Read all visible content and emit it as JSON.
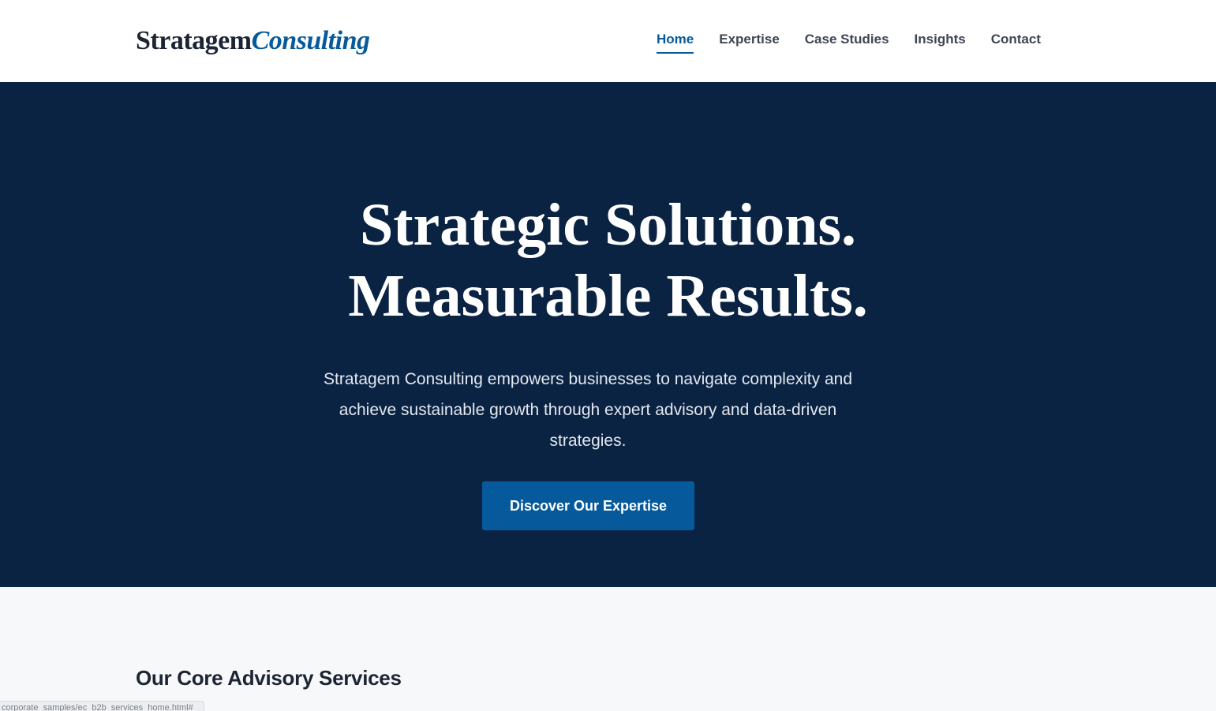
{
  "brand": {
    "name_main": "Stratagem",
    "name_accent": "Consulting"
  },
  "nav": {
    "items": [
      {
        "label": "Home",
        "active": true
      },
      {
        "label": "Expertise",
        "active": false
      },
      {
        "label": "Case Studies",
        "active": false
      },
      {
        "label": "Insights",
        "active": false
      },
      {
        "label": "Contact",
        "active": false
      }
    ]
  },
  "hero": {
    "title_line1": "Strategic Solutions.",
    "title_line2": "Measurable Results.",
    "subtitle": "Stratagem Consulting empowers businesses to navigate complexity and achieve sustainable growth through expert advisory and data-driven strategies.",
    "cta_label": "Discover Our Expertise"
  },
  "services": {
    "heading": "Our Core Advisory Services"
  },
  "status_bar": {
    "url": "corporate_samples/ec_b2b_services_home.html#"
  },
  "colors": {
    "primary": "#065a9c",
    "hero_bg": "#0a2343",
    "section_bg": "#f6f8fa",
    "text_dark": "#1d2433",
    "nav_text": "#3f4654"
  }
}
